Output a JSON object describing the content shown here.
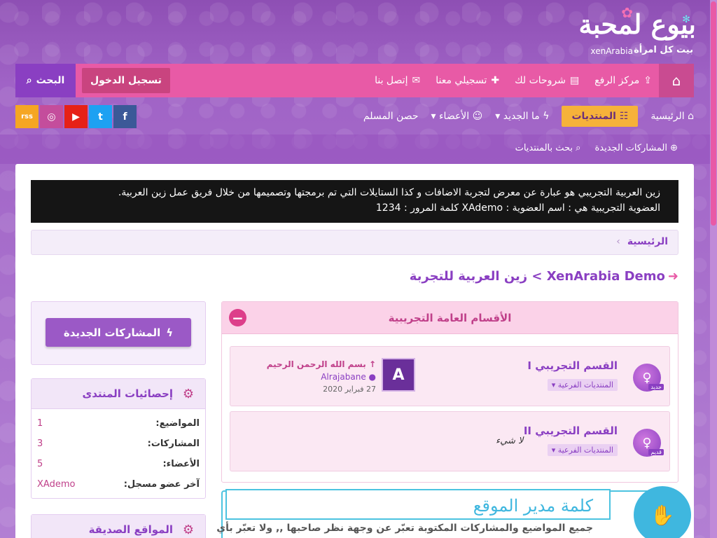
{
  "logo": {
    "name": "بيوع لمحبة",
    "tagline": "بيت كل امرأة",
    "brand": "xenArabia"
  },
  "topbar": {
    "items": [
      {
        "icon": "upload-icon",
        "label": "مركز الرفع"
      },
      {
        "icon": "book-icon",
        "label": "شروحات لك"
      },
      {
        "icon": "user-plus-icon",
        "label": "تسجيلي معنا"
      },
      {
        "icon": "envelope-icon",
        "label": "إتصل بنا"
      }
    ],
    "login": "تسجيل الدخول",
    "search": "البحث"
  },
  "mainnav": {
    "items": [
      {
        "label": "الرئيسية",
        "active": false
      },
      {
        "label": "المنتديات",
        "active": true
      },
      {
        "label": "ما الجديد",
        "active": false
      },
      {
        "label": "الأعضاء",
        "active": false
      },
      {
        "label": "حصن المسلم",
        "active": false
      }
    ],
    "social": [
      "f",
      "t",
      "▶",
      "◎",
      "rss"
    ]
  },
  "subnav": {
    "items": [
      "المشاركات الجديدة",
      "بحث بالمنتديات"
    ]
  },
  "notice": {
    "line1": "زين العربية التجريبي هو عبارة عن معرض لتجربة الاضافات و كذا الستايلات التي تم برمجتها وتصميمها من خلال فريق عمل زين العربية.",
    "line2": "العضوية التجريبية هي : اسم العضوية : XAdemo كلمة المرور : 1234"
  },
  "breadcrumb": {
    "home": "الرئيسية"
  },
  "page": {
    "title": "XenArabia Demo > زين العربية للتجربة"
  },
  "category": {
    "title": "الأقسام العامة التجريبية",
    "nodes": [
      {
        "title": "القسم التجريبي I",
        "sub": "المنتديات الفرعية",
        "tag": "جديد",
        "avatar": "A",
        "last_title": "بسم الله الرحمن الرحيم",
        "last_user": "Alrajabane",
        "last_date": "27 فبراير 2020"
      },
      {
        "title": "القسم التجريبي II",
        "sub": "المنتديات الفرعية",
        "tag": "قديم",
        "none": "لا شيء"
      }
    ]
  },
  "admin": {
    "title": "كلمة مدير الموقع",
    "text": "جميع المواضيع والمشاركات المكتوبة تعبّر عن وجهة نظر صاحبها ,, ولا تعبّر بأي"
  },
  "sidebar": {
    "newposts": "المشاركات الجديدة",
    "stats_title": "إحصائيات المنتدى",
    "stats": [
      {
        "label": "المواضيع:",
        "value": "1"
      },
      {
        "label": "المشاركات:",
        "value": "3"
      },
      {
        "label": "الأعضاء:",
        "value": "5"
      },
      {
        "label": "آخر عضو مسجل:",
        "value": "XAdemo"
      }
    ],
    "friends_title": "المواقع الصديقة"
  }
}
